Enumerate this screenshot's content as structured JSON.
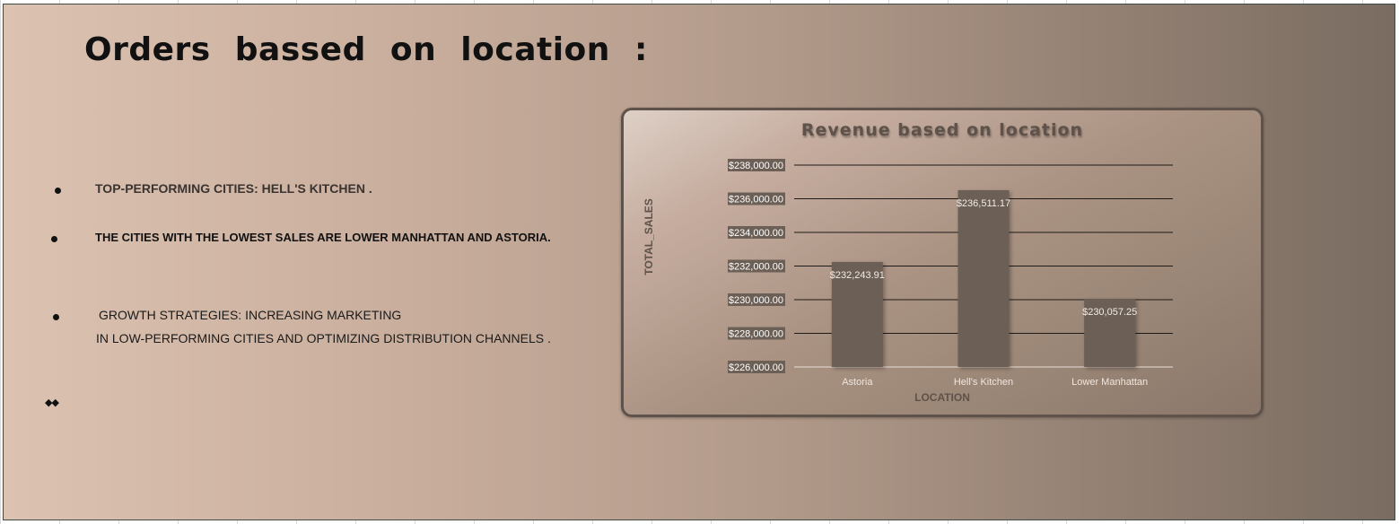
{
  "headline": "Orders bassed on location :",
  "bullets": {
    "b1": "TOP-PERFORMING CITIES: HELL'S KITCHEN .",
    "b2": "THE CITIES WITH THE LOWEST SALES ARE LOWER MANHATTAN AND ASTORIA.",
    "b3_line1": "GROWTH STRATEGIES: INCREASING MARKETING",
    "b3_line2": "IN LOW-PERFORMING CITIES AND OPTIMIZING DISTRIBUTION CHANNELS .",
    "b4": "◆◆"
  },
  "colors": {
    "bar": "#6c5f55",
    "grid": "#1e1a17",
    "tick_label_bg": "#6c5f55",
    "tick_label_text": "#ffffff",
    "title": "#5e524a"
  },
  "chart_data": {
    "type": "bar",
    "title": "Revenue based on location",
    "xlabel": "LOCATION",
    "ylabel": "TOTAL_SALES",
    "categories": [
      "Astoria",
      "Hell's Kitchen",
      "Lower Manhattan"
    ],
    "values": [
      232243.91,
      236511.17,
      230057.25
    ],
    "data_labels": [
      "$232,243.91",
      "$236,511.17",
      "$230,057.25"
    ],
    "ylim": [
      226000,
      238000
    ],
    "yticks": [
      226000,
      228000,
      230000,
      232000,
      234000,
      236000,
      238000
    ],
    "ytick_labels": [
      "$226,000.00",
      "$228,000.00",
      "$230,000.00",
      "$232,000.00",
      "$234,000.00",
      "$236,000.00",
      "$238,000.00"
    ],
    "grid": true,
    "legend": "none"
  }
}
